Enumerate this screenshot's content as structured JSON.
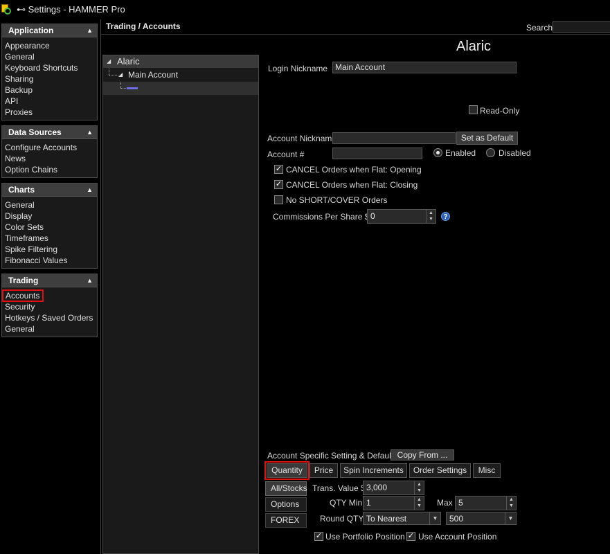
{
  "window": {
    "title": "⊷ Settings - HAMMER Pro"
  },
  "sidebar": {
    "sections": [
      {
        "title": "Application",
        "items": [
          "Appearance",
          "General",
          "Keyboard Shortcuts",
          "Sharing",
          "Backup",
          "API",
          "Proxies"
        ]
      },
      {
        "title": "Data Sources",
        "items": [
          "Configure Accounts",
          "News",
          "Option Chains"
        ]
      },
      {
        "title": "Charts",
        "items": [
          "General",
          "Display",
          "Color Sets",
          "Timeframes",
          "Spike Filtering",
          "Fibonacci Values"
        ]
      },
      {
        "title": "Trading",
        "items": [
          "Accounts",
          "Security",
          "Hotkeys / Saved Orders",
          "General"
        ]
      }
    ],
    "selected": "Accounts"
  },
  "header": {
    "breadcrumb": "Trading / Accounts",
    "search_label": "Search",
    "search_value": ""
  },
  "tree": {
    "root": "Alaric",
    "child": "Main Account"
  },
  "detail": {
    "title": "Alaric",
    "login_nickname_label": "Login Nickname",
    "login_nickname_value": "Main Account",
    "read_only_label": "Read-Only",
    "account_nickname_label": "Account Nickname",
    "account_nickname_value": "",
    "set_default_label": "Set as Default",
    "account_number_label": "Account #",
    "account_number_value": "",
    "enabled_label": "Enabled",
    "disabled_label": "Disabled",
    "cancel_opening_label": "CANCEL Orders when Flat: Opening",
    "cancel_closing_label": "CANCEL Orders when Flat: Closing",
    "no_short_label": "No SHORT/COVER Orders",
    "commissions_label": "Commissions Per Share $",
    "commissions_value": "0",
    "help_glyph": "?"
  },
  "defaults": {
    "title": "Account Specific Setting & Defaults",
    "copy_from_label": "Copy From ...",
    "tabs": [
      "Quantity",
      "Price",
      "Spin Increments",
      "Order Settings",
      "Misc"
    ],
    "active_tab": "Quantity",
    "subtabs": [
      "All/Stocks",
      "Options",
      "FOREX"
    ],
    "active_subtab": "All/Stocks",
    "trans_value_label": "Trans. Value $",
    "trans_value": "3,000",
    "qty_min_label": "QTY Min",
    "qty_min": "1",
    "max_label": "Max",
    "max_value": "5",
    "round_qty_label": "Round QTY",
    "round_qty_value": "To Nearest",
    "round_amount": "500",
    "use_portfolio_label": "Use Portfolio Position",
    "use_account_label": "Use Account Position"
  },
  "icons": {
    "checkmark": "✓",
    "caret_up": "▲",
    "caret_down": "▼",
    "tree_expanded": "◢"
  },
  "colors": {
    "accent_red": "#e01010",
    "tree_marker": "#6e6ee6",
    "help_blue": "#2a5fb8"
  }
}
